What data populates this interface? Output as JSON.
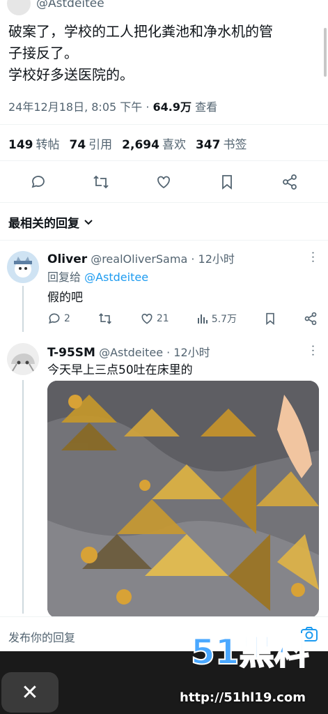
{
  "post": {
    "author_handle": "@Astdeitee",
    "text_line1": "破案了，学校的工人把化粪池和净水机的管",
    "text_line2": "子接反了。",
    "text_line3": "学校好多送医院的。",
    "timestamp": "24年12月18日, 8:05 下午 · ",
    "views": "64.9万",
    "views_label": " 查看",
    "stats": [
      {
        "num": "149",
        "label": "转帖"
      },
      {
        "num": "74",
        "label": "引用"
      },
      {
        "num": "2,694",
        "label": "喜欢"
      },
      {
        "num": "347",
        "label": "书签"
      }
    ]
  },
  "sort_label": "最相关的回复",
  "replies": [
    {
      "name": "Oliver",
      "handle": "@realOliverSama",
      "time": " · 12小时",
      "reply_to_prefix": "回复给 ",
      "reply_to": "@Astdeitee",
      "text": "假的吧",
      "replies_count": "2",
      "likes": "21",
      "views": "5.7万"
    },
    {
      "name": "T-95SM",
      "handle": "@Astdeitee",
      "time": " · 12小时",
      "text": "今天早上三点50吐在床里的"
    }
  ],
  "reply_bar": {
    "placeholder": "发布你的回复"
  },
  "bottom": {
    "close": "✕",
    "url": "http://51hl19.com"
  },
  "watermark": "51黑料",
  "colors": {
    "accent": "#1d9bf0",
    "muted": "#536471",
    "text": "#0f1419"
  }
}
